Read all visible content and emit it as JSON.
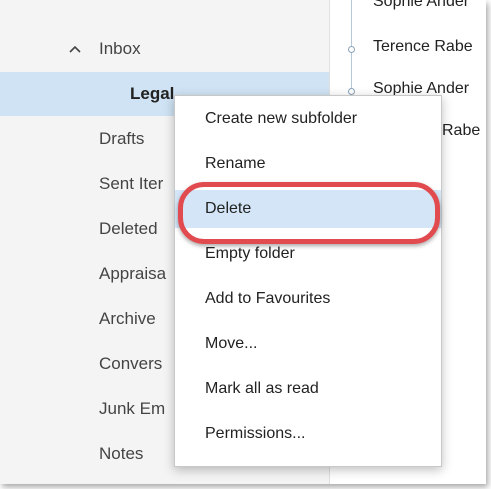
{
  "folders": {
    "inbox": "Inbox",
    "legal": "Legal",
    "drafts": "Drafts",
    "sent": "Sent Iter",
    "deleted": "Deleted",
    "appraisals": "Appraisa",
    "archive": "Archive",
    "conversation": "Convers",
    "junk": "Junk Em",
    "notes": "Notes"
  },
  "messages": [
    {
      "sender": "Sophie Ander"
    },
    {
      "sender": "Terence Rabe"
    },
    {
      "sender": "Sophie Ander"
    },
    {
      "sender": "Rabe"
    }
  ],
  "context_menu": {
    "items": [
      "Create new subfolder",
      "Rename",
      "Delete",
      "Empty folder",
      "Add to Favourites",
      "Move...",
      "Mark all as read",
      "Permissions..."
    ],
    "highlighted": "Delete"
  },
  "colors": {
    "selection": "#cfe3f4",
    "menu_hover": "#d3e5f7",
    "annotation_ring": "#e14a4f"
  },
  "icons": {
    "inbox_expander": "chevron-up-icon"
  }
}
